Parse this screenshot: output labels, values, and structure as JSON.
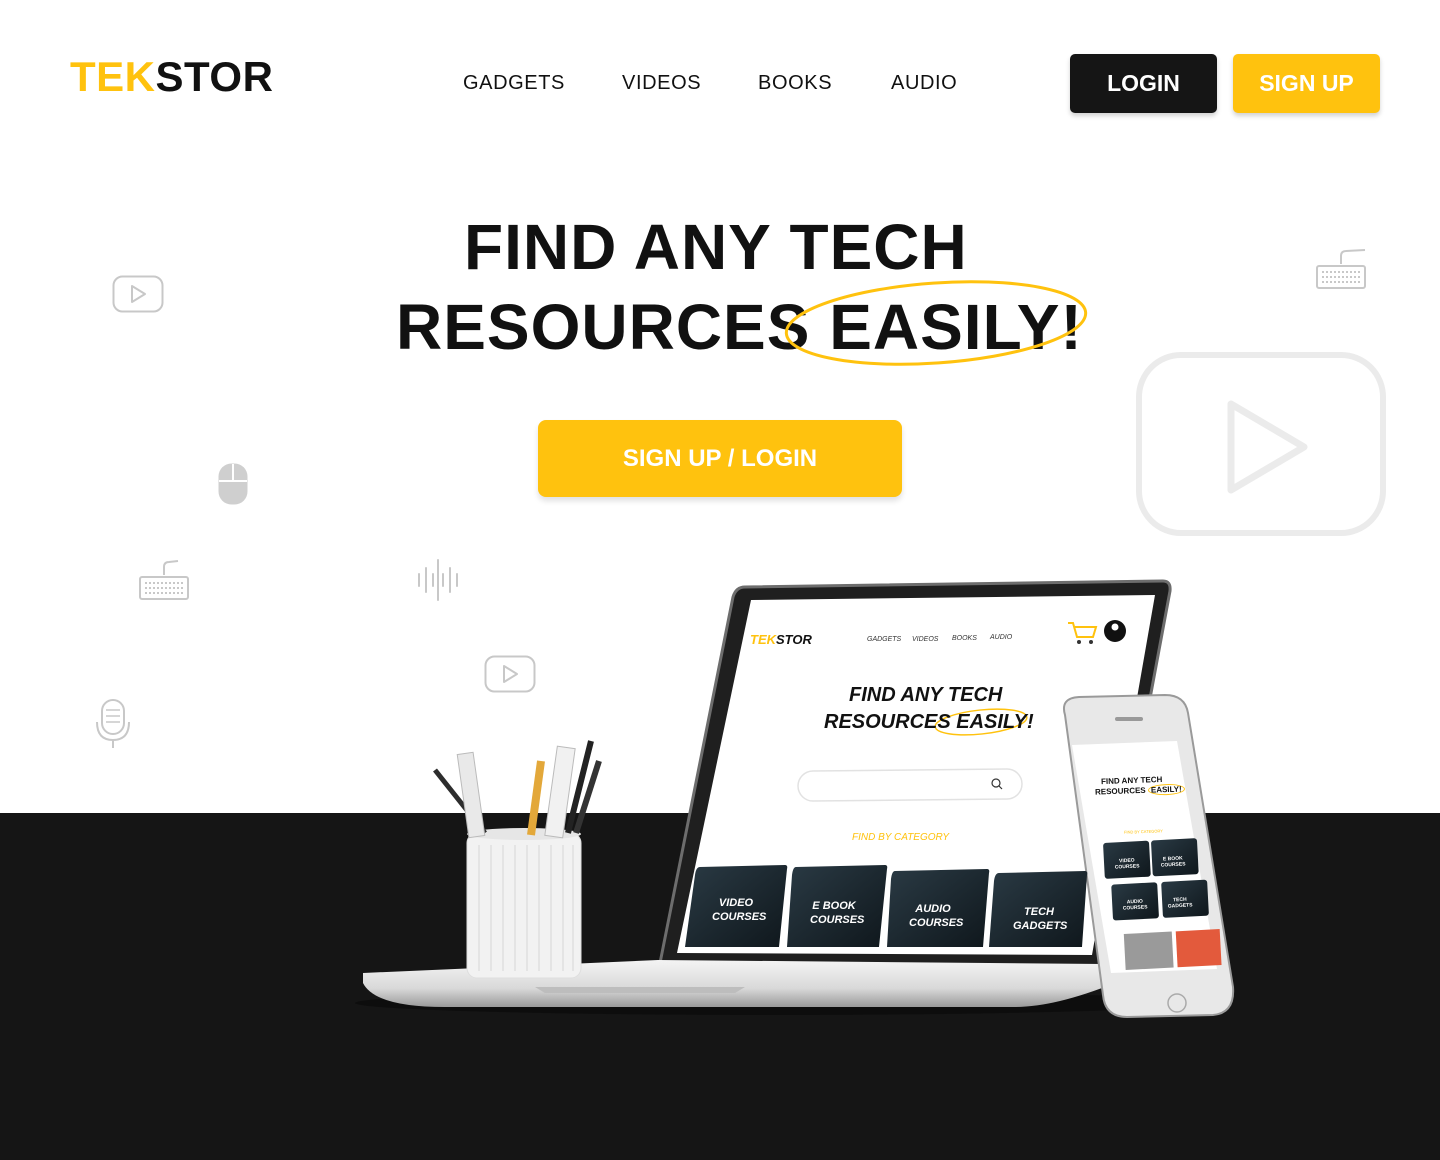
{
  "header": {
    "logo_part1": "TEK",
    "logo_part2": "STOR",
    "nav": [
      "GADGETS",
      "VIDEOS",
      "BOOKS",
      "AUDIO"
    ],
    "login_label": "LOGIN",
    "signup_label": "SIGN UP"
  },
  "hero": {
    "line1": "FIND ANY TECH",
    "line2_a": "RESOURCES ",
    "line2_b": "EASILY!",
    "cta_label": "SIGN UP / LOGIN"
  },
  "mockup": {
    "laptop": {
      "logo_part1": "TEK",
      "logo_part2": "STOR",
      "nav": [
        "GADGETS",
        "VIDEOS",
        "BOOKS",
        "AUDIO"
      ],
      "title_line1": "FIND ANY TECH",
      "title_line2_a": "RESOURCES ",
      "title_line2_b": "EASILY!",
      "category_label": "FIND BY CATEGORY",
      "cards": [
        [
          "VIDEO",
          "COURSES"
        ],
        [
          "E BOOK",
          "COURSES"
        ],
        [
          "AUDIO",
          "COURSES"
        ],
        [
          "TECH",
          "GADGETS"
        ]
      ]
    },
    "phone": {
      "title_line1": "FIND ANY TECH",
      "title_line2_a": "RESOURCES ",
      "title_line2_b": "EASILY!",
      "category_label": "FIND BY CATEGORY",
      "cards": [
        [
          "VIDEO",
          "COURSES"
        ],
        [
          "E BOOK",
          "COURSES"
        ],
        [
          "AUDIO",
          "COURSES"
        ],
        [
          "TECH",
          "GADGETS"
        ]
      ]
    }
  },
  "colors": {
    "accent": "#FFC20E",
    "dark": "#151515",
    "background": "#FFFFFF",
    "icon_gray": "#C8C8C8"
  }
}
